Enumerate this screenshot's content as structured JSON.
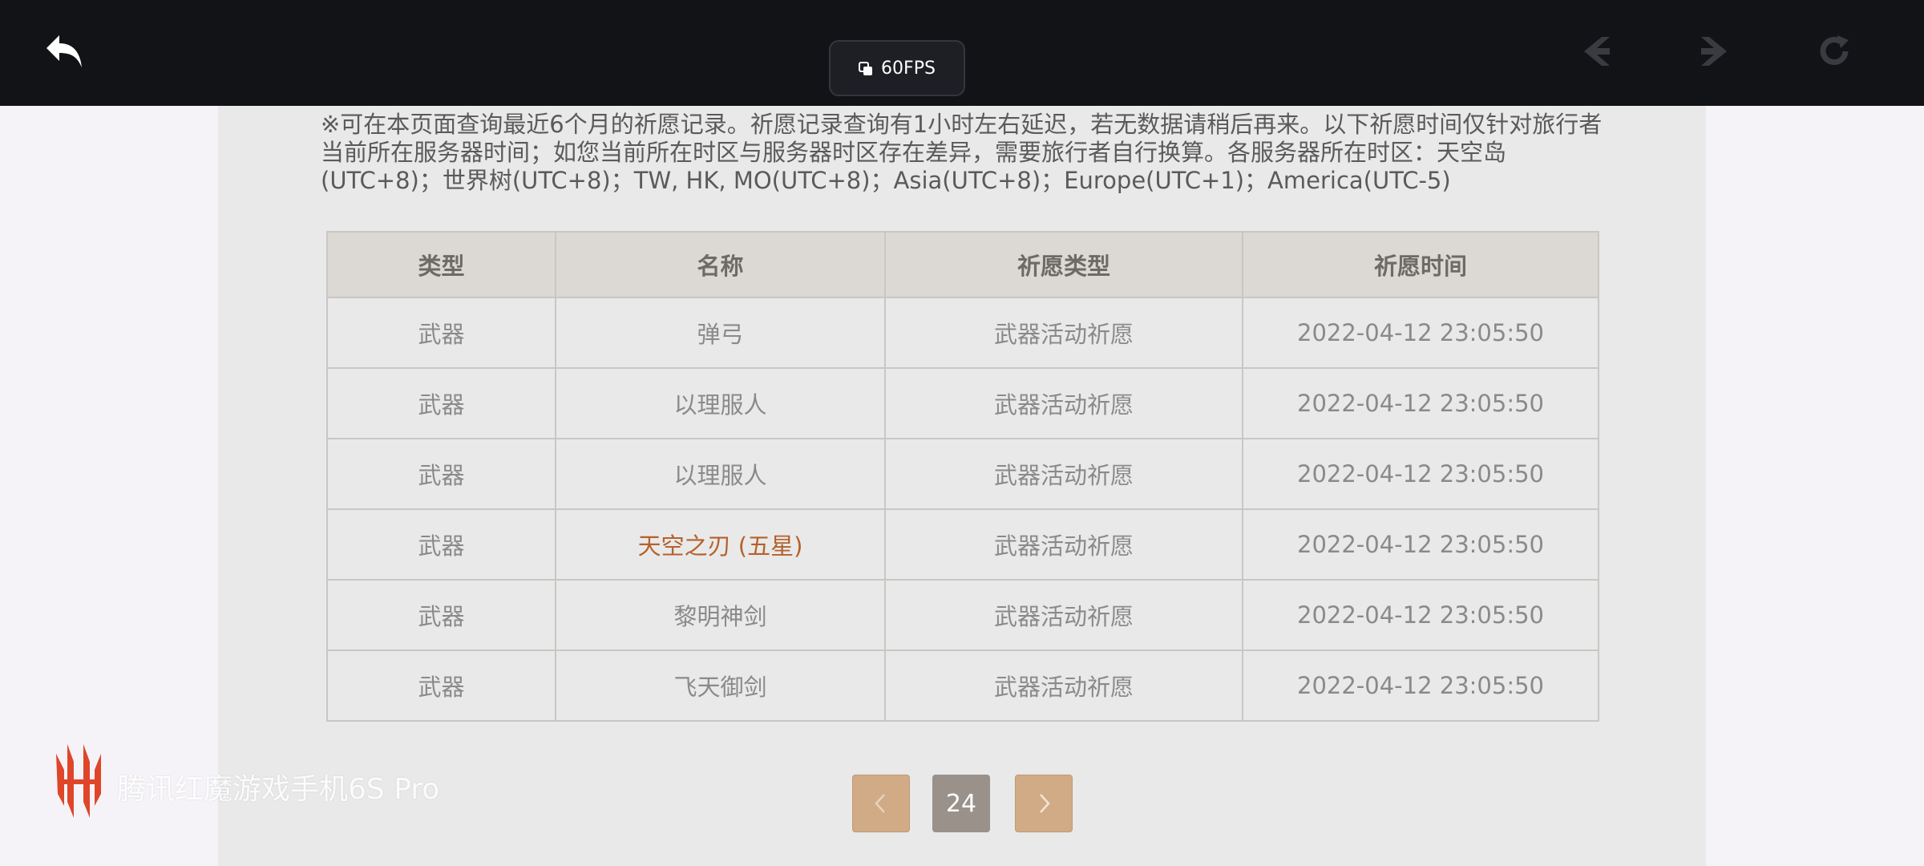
{
  "topbar": {
    "fps_label": "60FPS",
    "icons": [
      "back-icon",
      "fps-icon",
      "nav-prev-icon",
      "nav-next-icon",
      "reload-icon"
    ]
  },
  "notice": "※可在本页面查询最近6个月的祈愿记录。祈愿记录查询有1小时左右延迟，若无数据请稍后再来。以下祈愿时间仅针对旅行者当前所在服务器时间；如您当前所在时区与服务器时区存在差异，需要旅行者自行换算。各服务器所在时区：天空岛(UTC+8)；世界树(UTC+8)；TW, HK, MO(UTC+8)；Asia(UTC+8)；Europe(UTC+1)；America(UTC-5)",
  "table": {
    "headers": [
      "类型",
      "名称",
      "祈愿类型",
      "祈愿时间"
    ],
    "rows": [
      {
        "type": "武器",
        "name": "弹弓",
        "wish_type": "武器活动祈愿",
        "time": "2022-04-12 23:05:50"
      },
      {
        "type": "武器",
        "name": "以理服人",
        "wish_type": "武器活动祈愿",
        "time": "2022-04-12 23:05:50"
      },
      {
        "type": "武器",
        "name": "以理服人",
        "wish_type": "武器活动祈愿",
        "time": "2022-04-12 23:05:50"
      },
      {
        "type": "武器",
        "name": "天空之刃 (五星)",
        "wish_type": "武器活动祈愿",
        "time": "2022-04-12 23:05:50"
      },
      {
        "type": "武器",
        "name": "黎明神剑",
        "wish_type": "武器活动祈愿",
        "time": "2022-04-12 23:05:50"
      },
      {
        "type": "武器",
        "name": "飞天御剑",
        "wish_type": "武器活动祈愿",
        "time": "2022-04-12 23:05:50"
      }
    ]
  },
  "pagination": {
    "current_page": "24",
    "prev_icon": "chevron-left-icon",
    "next_icon": "chevron-right-icon"
  },
  "watermark": {
    "text": "腾讯红魔游戏手机6S Pro"
  },
  "colors": {
    "topbar_bg": "#121316",
    "panel_bg": "#e9e9e9",
    "header_bg": "#dcd8d3",
    "five_star": "#b5612c",
    "page_button": "#d0ab85",
    "page_current": "#9a918a"
  }
}
